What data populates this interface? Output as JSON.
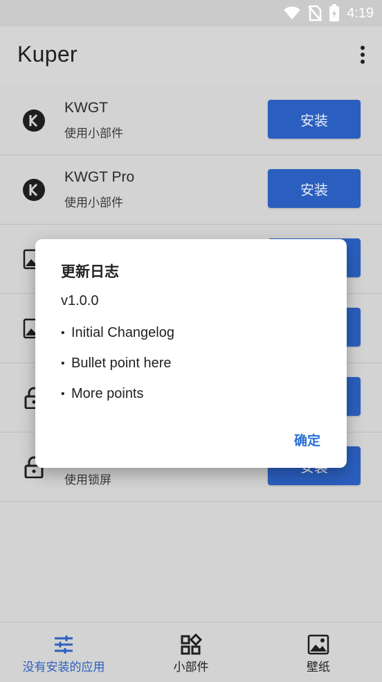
{
  "status_bar": {
    "time": "4:19"
  },
  "app_bar": {
    "title": "Kuper"
  },
  "list": [
    {
      "title": "KWGT",
      "subtitle": "使用小部件",
      "button": "安装",
      "icon": "kwgt-logo-icon"
    },
    {
      "title": "KWGT Pro",
      "subtitle": "使用小部件",
      "button": "安装",
      "icon": "kwgt-logo-icon"
    },
    {
      "title": "",
      "subtitle": "",
      "button": "安装",
      "icon": "image-icon"
    },
    {
      "title": "",
      "subtitle": "",
      "button": "安装",
      "icon": "image-icon"
    },
    {
      "title": "",
      "subtitle": "",
      "button": "安装",
      "icon": "lock-icon"
    },
    {
      "title": "",
      "subtitle": "使用锁屏",
      "button": "安装",
      "icon": "lock-icon"
    }
  ],
  "dialog": {
    "title": "更新日志",
    "version": "v1.0.0",
    "bullets": [
      "Initial Changelog",
      "Bullet point here",
      "More points"
    ],
    "ok": "确定"
  },
  "bottom_nav": [
    {
      "label": "没有安装的应用",
      "icon": "sliders-icon",
      "active": true
    },
    {
      "label": "小部件",
      "icon": "widgets-icon",
      "active": false
    },
    {
      "label": "壁纸",
      "icon": "wallpaper-icon",
      "active": false
    }
  ],
  "colors": {
    "accent": "#2b5fbf",
    "dialog_button": "#2b6fd6"
  }
}
